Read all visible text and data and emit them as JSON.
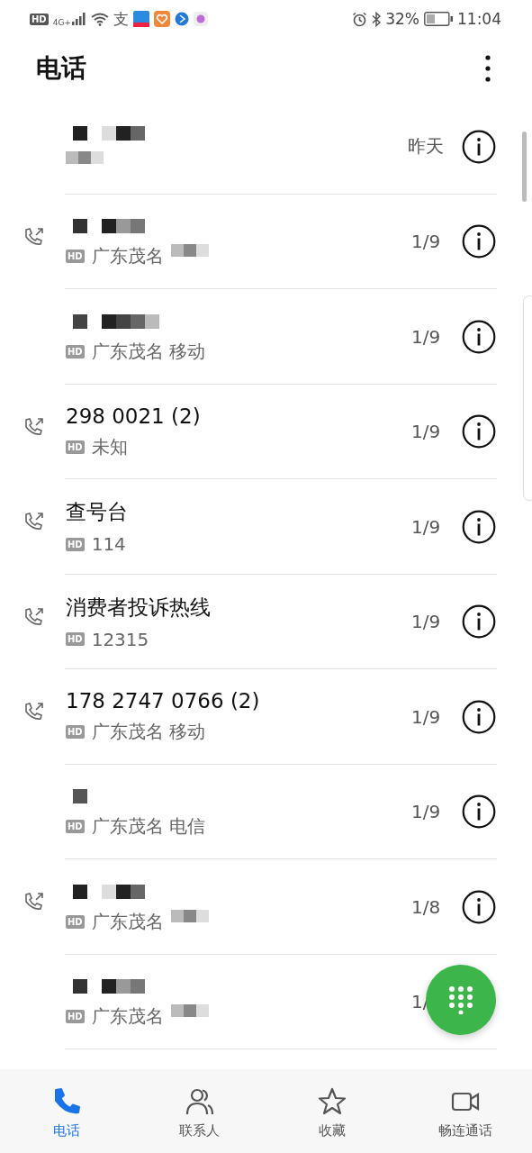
{
  "status_bar": {
    "network_badge": "HD",
    "network": "4G+",
    "glyph": "支",
    "battery": "32%",
    "time": "11:04"
  },
  "title": "电话",
  "calls": [
    {
      "call_icon": false,
      "name_redacted": true,
      "subtitle_redacted": true,
      "date": "昨天"
    },
    {
      "call_icon": true,
      "name_redacted": true,
      "badge": "HD",
      "subtitle": "广东茂名",
      "subtitle_redacted": true,
      "date": "1/9"
    },
    {
      "call_icon": false,
      "name_redacted": true,
      "badge": "HD",
      "subtitle": "广东茂名 移动",
      "date": "1/9"
    },
    {
      "call_icon": true,
      "name": "298 0021 (2)",
      "badge": "HD",
      "subtitle": "未知",
      "date": "1/9"
    },
    {
      "call_icon": true,
      "name": "查号台",
      "badge": "HD",
      "subtitle": "114",
      "date": "1/9"
    },
    {
      "call_icon": true,
      "name": "消费者投诉热线",
      "badge": "HD",
      "subtitle": "12315",
      "date": "1/9"
    },
    {
      "call_icon": true,
      "name": "178 2747 0766 (2)",
      "badge": "HD",
      "subtitle": "广东茂名 移动",
      "date": "1/9"
    },
    {
      "call_icon": false,
      "name_redacted": true,
      "badge": "HD",
      "subtitle": "广东茂名 电信",
      "date": "1/9"
    },
    {
      "call_icon": true,
      "name_redacted": true,
      "badge": "HD",
      "subtitle": "广东茂名",
      "subtitle_redacted": true,
      "date": "1/8"
    },
    {
      "call_icon": false,
      "name_redacted": true,
      "badge": "HD",
      "subtitle": "广东茂名",
      "subtitle_redacted": true,
      "date": "1/"
    }
  ],
  "tabs": [
    {
      "label": "电话",
      "selected": true
    },
    {
      "label": "联系人",
      "selected": false
    },
    {
      "label": "收藏",
      "selected": false
    },
    {
      "label": "畅连通话",
      "selected": false
    }
  ]
}
